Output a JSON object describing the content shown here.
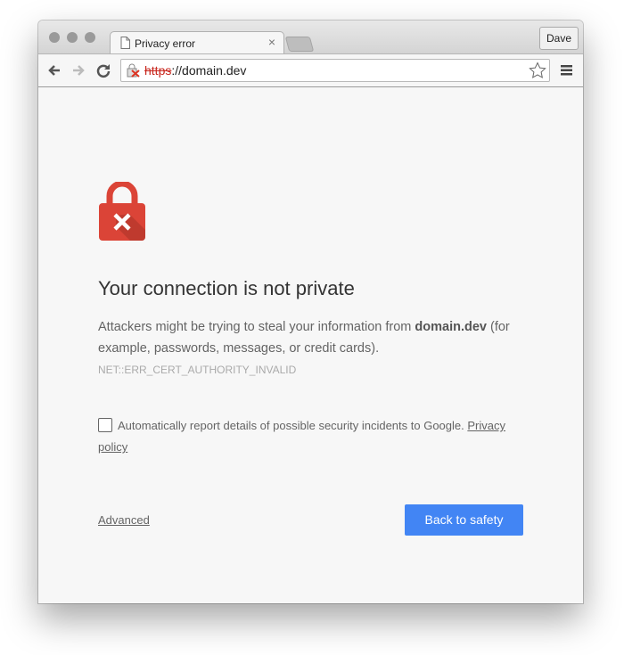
{
  "browser": {
    "tab_title": "Privacy error",
    "profile_name": "Dave",
    "url_scheme": "https",
    "url_rest": "://domain.dev"
  },
  "page": {
    "title": "Your connection is not private",
    "description_prefix": "Attackers might be trying to steal your information from ",
    "domain": "domain.dev",
    "description_suffix": " (for example, passwords, messages, or credit cards).",
    "error_code": "NET::ERR_CERT_AUTHORITY_INVALID",
    "report_text": "Automatically report details of possible security incidents to Google. ",
    "report_checked": false,
    "privacy_link": "Privacy policy",
    "advanced_link": "Advanced",
    "back_button": "Back to safety"
  },
  "colors": {
    "accent": "#4285f4",
    "error_red": "#db4437",
    "background": "#f7f7f7"
  }
}
